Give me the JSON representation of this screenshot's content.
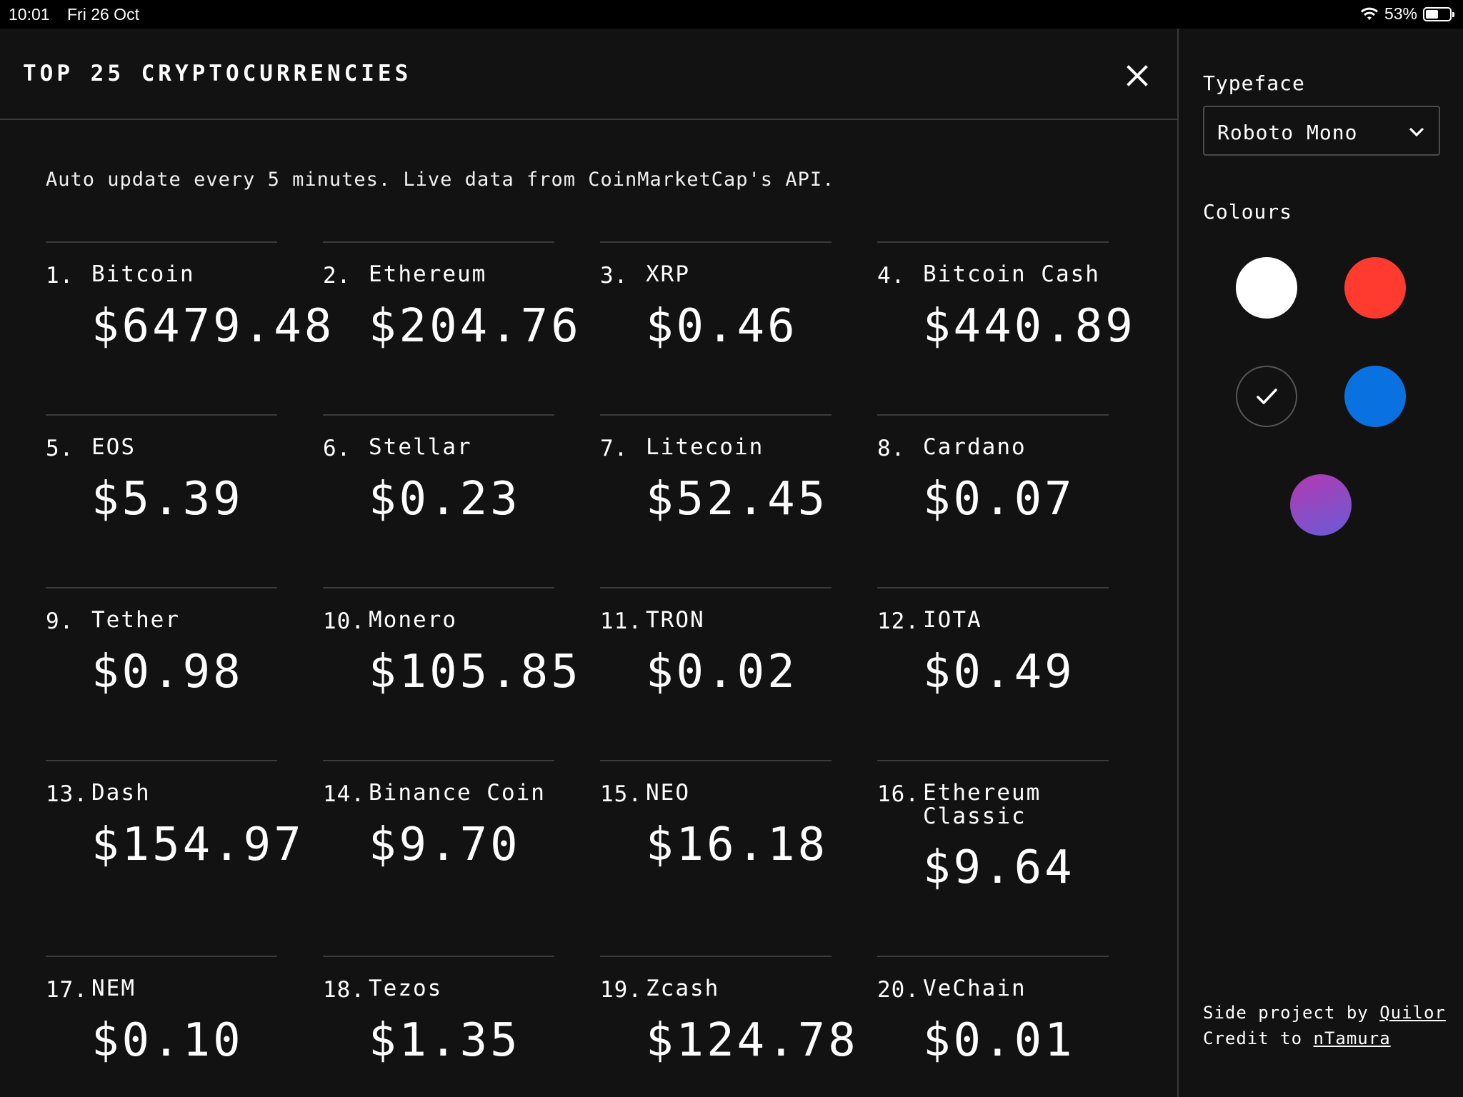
{
  "status_bar": {
    "time": "10:01",
    "date": "Fri 26 Oct",
    "battery_percent": "53%",
    "battery_level": 0.53
  },
  "header": {
    "title": "TOP 25 CRYPTOCURRENCIES"
  },
  "subtitle": "Auto update every 5 minutes. Live data from CoinMarketCap's API.",
  "coins": [
    {
      "rank": "1.",
      "name": "Bitcoin",
      "price": "$6479.48"
    },
    {
      "rank": "2.",
      "name": "Ethereum",
      "price": "$204.76"
    },
    {
      "rank": "3.",
      "name": "XRP",
      "price": "$0.46"
    },
    {
      "rank": "4.",
      "name": "Bitcoin Cash",
      "price": "$440.89"
    },
    {
      "rank": "5.",
      "name": "EOS",
      "price": "$5.39"
    },
    {
      "rank": "6.",
      "name": "Stellar",
      "price": "$0.23"
    },
    {
      "rank": "7.",
      "name": "Litecoin",
      "price": "$52.45"
    },
    {
      "rank": "8.",
      "name": "Cardano",
      "price": "$0.07"
    },
    {
      "rank": "9.",
      "name": "Tether",
      "price": "$0.98"
    },
    {
      "rank": "10.",
      "name": "Monero",
      "price": "$105.85"
    },
    {
      "rank": "11.",
      "name": "TRON",
      "price": "$0.02"
    },
    {
      "rank": "12.",
      "name": "IOTA",
      "price": "$0.49"
    },
    {
      "rank": "13.",
      "name": "Dash",
      "price": "$154.97"
    },
    {
      "rank": "14.",
      "name": "Binance Coin",
      "price": "$9.70"
    },
    {
      "rank": "15.",
      "name": "NEO",
      "price": "$16.18"
    },
    {
      "rank": "16.",
      "name": "Ethereum Classic",
      "price": "$9.64"
    },
    {
      "rank": "17.",
      "name": "NEM",
      "price": "$0.10"
    },
    {
      "rank": "18.",
      "name": "Tezos",
      "price": "$1.35"
    },
    {
      "rank": "19.",
      "name": "Zcash",
      "price": "$124.78"
    },
    {
      "rank": "20.",
      "name": "VeChain",
      "price": "$0.01"
    }
  ],
  "sidebar": {
    "typeface_label": "Typeface",
    "typeface_value": "Roboto Mono",
    "colours_label": "Colours",
    "swatches": [
      {
        "name": "white",
        "color": "#ffffff",
        "selected": false
      },
      {
        "name": "red",
        "color": "#ff3b30",
        "selected": false
      },
      {
        "name": "black",
        "color": "#121212",
        "selected": true
      },
      {
        "name": "blue",
        "color": "#0a72e0",
        "selected": false
      },
      {
        "name": "purple-gradient",
        "color": "#9b3fb0",
        "selected": false
      }
    ],
    "footer": {
      "line1_prefix": "Side project by ",
      "line1_link": "Quilor",
      "line2_prefix": "Credit to ",
      "line2_link": "nTamura"
    }
  },
  "colors": {
    "background": "#121212",
    "text": "#ffffff",
    "divider": "#3a3a3a"
  }
}
